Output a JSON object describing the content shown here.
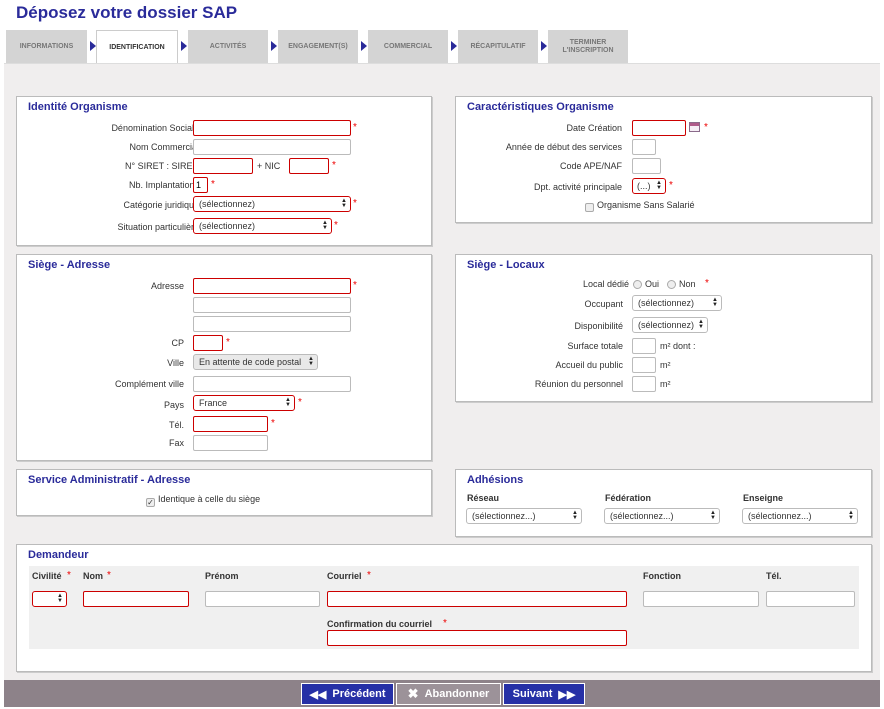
{
  "page_title": "Déposez votre dossier SAP",
  "steps": [
    {
      "label": "INFORMATIONS",
      "active": false
    },
    {
      "label": "IDENTIFICATION",
      "active": true
    },
    {
      "label": "ACTIVITÉS",
      "active": false
    },
    {
      "label": "ENGAGEMENT(S)",
      "active": false
    },
    {
      "label": "COMMERCIAL",
      "active": false
    },
    {
      "label": "RÉCAPITULATIF",
      "active": false
    },
    {
      "label": "TERMINER L'INSCRIPTION",
      "active": false
    }
  ],
  "identite": {
    "title": "Identité Organisme",
    "denomination_label": "Dénomination Sociale",
    "nom_commercial_label": "Nom Commercial",
    "siret_label": "N° SIRET : SIREN",
    "nic_label": "+ NIC",
    "nb_implantations_label": "Nb. Implantations",
    "nb_implantations_value": "1",
    "categorie_label": "Catégorie juridique",
    "categorie_value": "(sélectionnez)",
    "situation_label": "Situation particulière",
    "situation_value": "(sélectionnez)"
  },
  "caracteristiques": {
    "title": "Caractéristiques Organisme",
    "date_creation_label": "Date Création",
    "annee_debut_label": "Année de début des services",
    "code_ape_label": "Code APE/NAF",
    "dpt_label": "Dpt. activité principale",
    "dpt_value": "(...)",
    "sans_salarie_label": "Organisme Sans Salarié"
  },
  "siege_adresse": {
    "title": "Siège - Adresse",
    "adresse_label": "Adresse",
    "cp_label": "CP",
    "ville_label": "Ville",
    "ville_value": "En attente de code postal",
    "complement_label": "Complément ville",
    "pays_label": "Pays",
    "pays_value": "France",
    "tel_label": "Tél.",
    "fax_label": "Fax"
  },
  "siege_locaux": {
    "title": "Siège - Locaux",
    "local_dedie_label": "Local dédié",
    "oui_label": "Oui",
    "non_label": "Non",
    "occupant_label": "Occupant",
    "occupant_value": "(sélectionnez)",
    "disponibilite_label": "Disponibilité",
    "disponibilite_value": "(sélectionnez)",
    "surface_label": "Surface totale",
    "surface_unit": "m² dont :",
    "accueil_label": "Accueil du public",
    "accueil_unit": "m²",
    "reunion_label": "Réunion du personnel",
    "reunion_unit": "m²"
  },
  "service_admin": {
    "title": "Service Administratif - Adresse",
    "identique_label": "Identique à celle du siège"
  },
  "adhesions": {
    "title": "Adhésions",
    "reseau_label": "Réseau",
    "reseau_value": "(sélectionnez...)",
    "federation_label": "Fédération",
    "federation_value": "(sélectionnez...)",
    "enseigne_label": "Enseigne",
    "enseigne_value": "(sélectionnez...)"
  },
  "demandeur": {
    "title": "Demandeur",
    "civilite_label": "Civilité",
    "nom_label": "Nom",
    "prenom_label": "Prénom",
    "courriel_label": "Courriel",
    "fonction_label": "Fonction",
    "tel_label": "Tél.",
    "confirmation_label": "Confirmation du courriel"
  },
  "required_mark": "*",
  "buttons": {
    "precedent": "Précédent",
    "abandonner": "Abandonner",
    "suivant": "Suivant"
  },
  "colors": {
    "title_blue": "#2a2b9a",
    "button_blue": "#2630a6",
    "error_red": "#cc0000",
    "bar_grey": "#8d8289"
  }
}
